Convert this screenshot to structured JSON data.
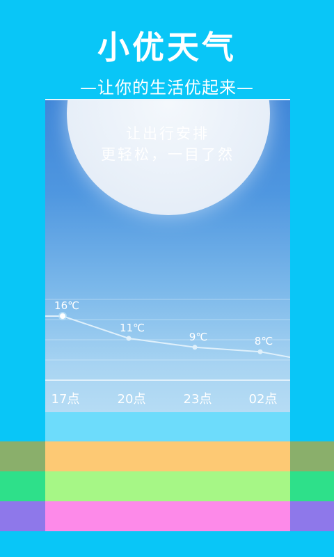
{
  "header": {
    "title": "小优天气",
    "subtitle": "—让你的生活优起来—"
  },
  "screen": {
    "tagline_line1": "让出行安排",
    "tagline_line2": "更轻松，一目了然"
  },
  "chart_data": {
    "type": "line",
    "categories": [
      "17点",
      "20点",
      "23点",
      "02点"
    ],
    "values": [
      16,
      11,
      9,
      8
    ],
    "labels": [
      "16℃",
      "11℃",
      "9℃",
      "8℃"
    ]
  },
  "colors": {
    "background": "#09c6f7",
    "band_cyan": "#6ddcfb",
    "band_orange": "#fdc974",
    "band_green": "#a6f786",
    "band_pink": "#fd8ae9",
    "side_olive": "#8aaf6b",
    "side_teal": "#2ee08a",
    "side_purple": "#8e78ea"
  }
}
